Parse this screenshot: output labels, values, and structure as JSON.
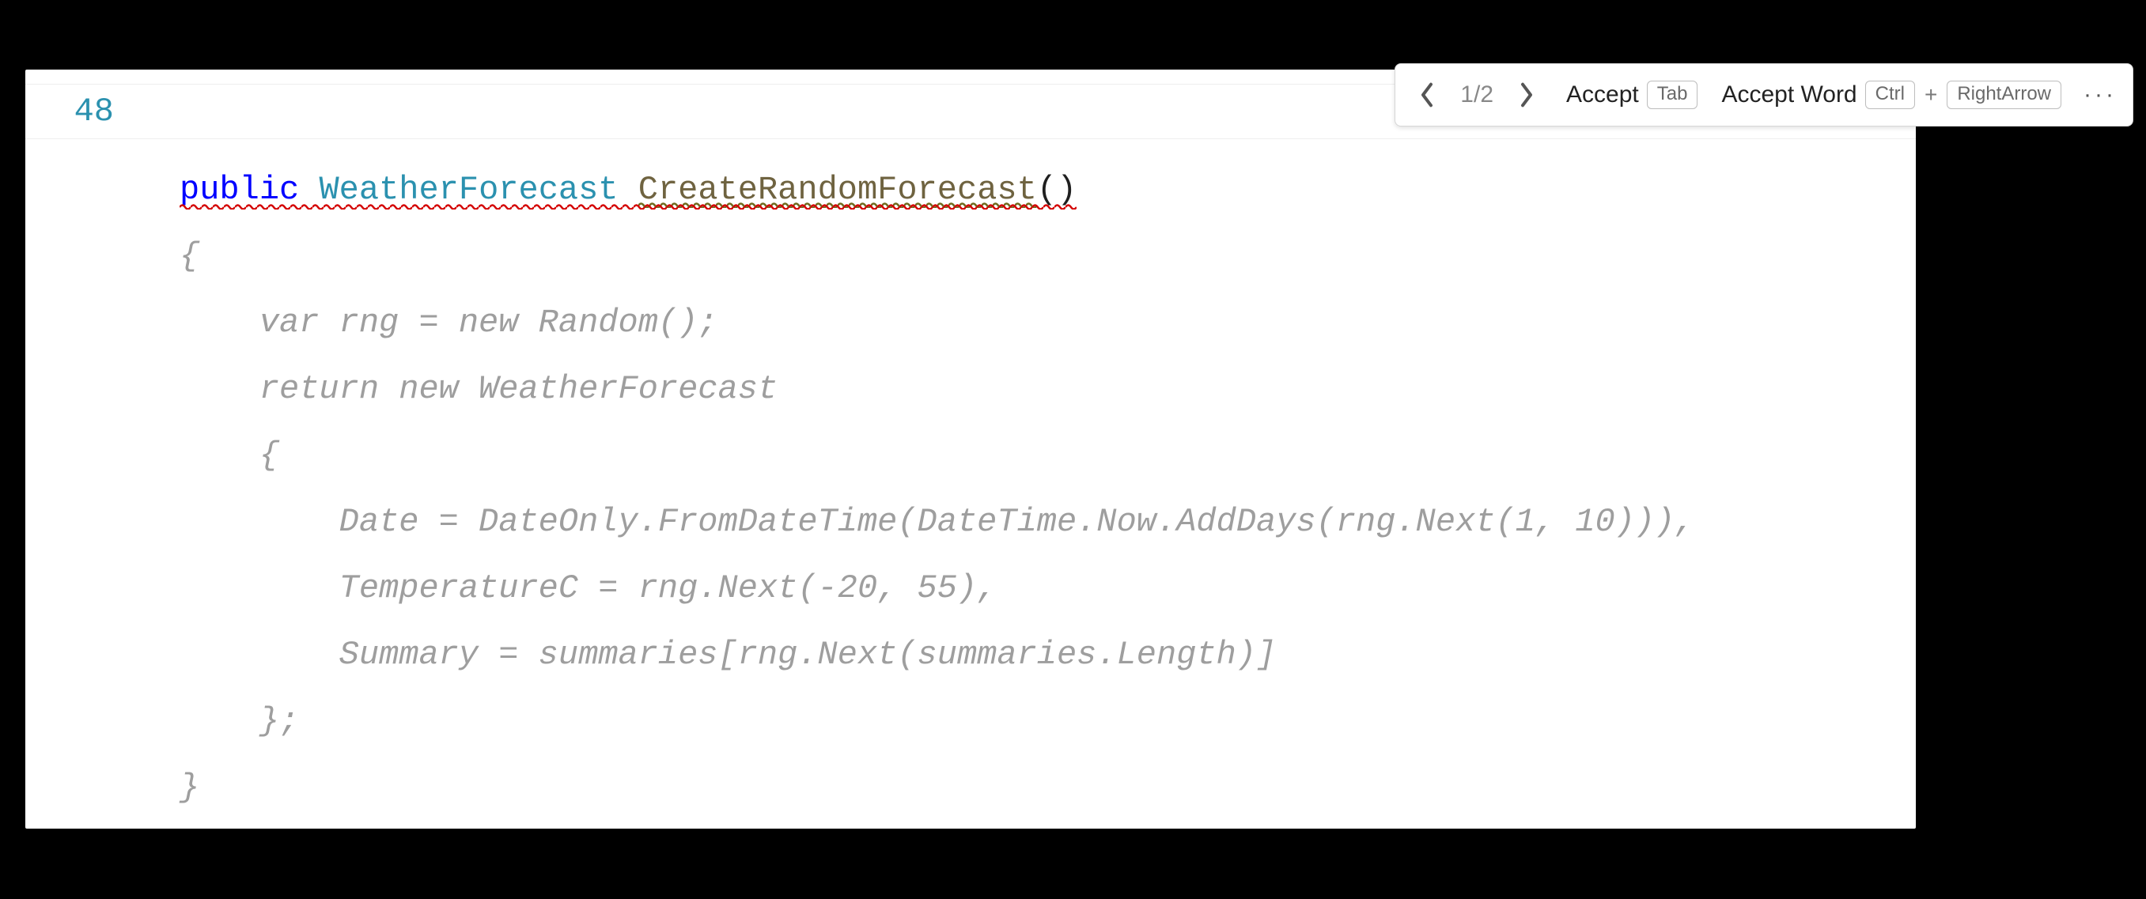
{
  "toolbar": {
    "counter": "1/2",
    "accept_label": "Accept",
    "accept_key": "Tab",
    "accept_word_label": "Accept Word",
    "accept_word_key1": "Ctrl",
    "accept_word_plus": "+",
    "accept_word_key2": "RightArrow",
    "more": "···"
  },
  "gutter": {
    "line_number": "48"
  },
  "code": {
    "sig_public": "public",
    "sig_type": "WeatherForecast",
    "sig_method": "CreateRandomForecast",
    "sig_parens": "()",
    "ghost_line2": "{",
    "ghost_line3": "    var rng = new Random();",
    "ghost_line4": "    return new WeatherForecast",
    "ghost_line5": "    {",
    "ghost_line6": "        Date = DateOnly.FromDateTime(DateTime.Now.AddDays(rng.Next(1, 10))),",
    "ghost_line7": "        TemperatureC = rng.Next(-20, 55),",
    "ghost_line8": "        Summary = summaries[rng.Next(summaries.Length)]",
    "ghost_line9": "    };",
    "ghost_line10": "}"
  }
}
